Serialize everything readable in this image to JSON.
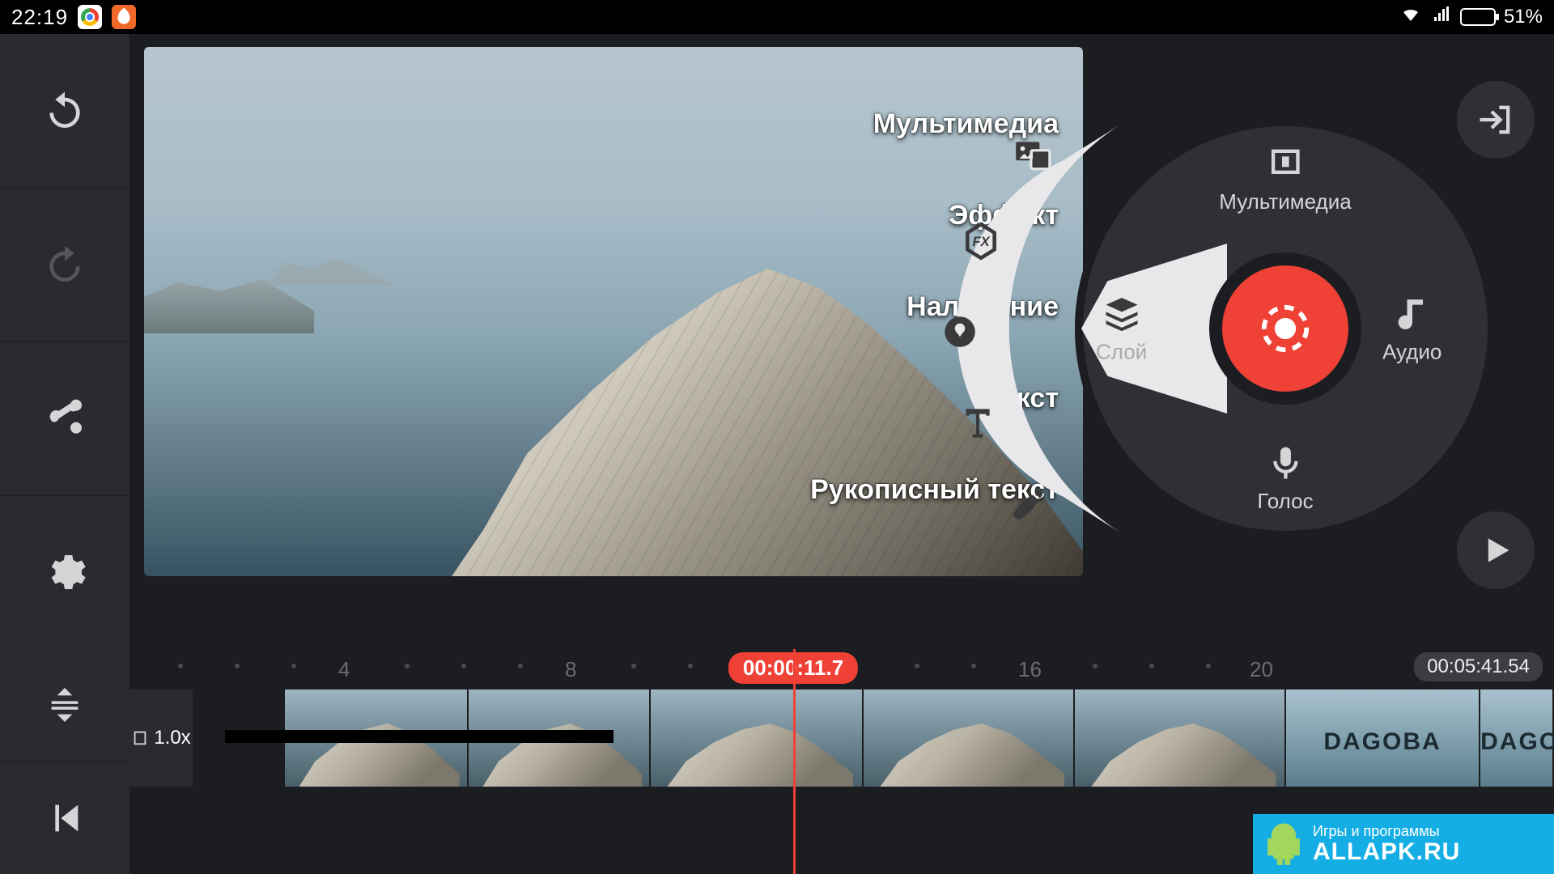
{
  "status": {
    "time": "22:19",
    "battery_pct": "51%"
  },
  "overlay_menu": {
    "multimedia": "Мультимедиа",
    "effect": "Эффект",
    "overlay": "Наложение",
    "text": "Текст",
    "handwriting": "Рукописный текст"
  },
  "wheel": {
    "multimedia": "Мультимедиа",
    "audio": "Аудио",
    "voice": "Голос",
    "layer": "Слой"
  },
  "timeline": {
    "ticks": {
      "t4": "4",
      "t8": "8",
      "t16": "16",
      "t20": "20"
    },
    "playhead": "00:00:11.7",
    "total": "00:05:41.54",
    "speed": "1.0x"
  },
  "watermark": {
    "line1": "Игры и программы",
    "line2": "ALLAPK.RU"
  }
}
